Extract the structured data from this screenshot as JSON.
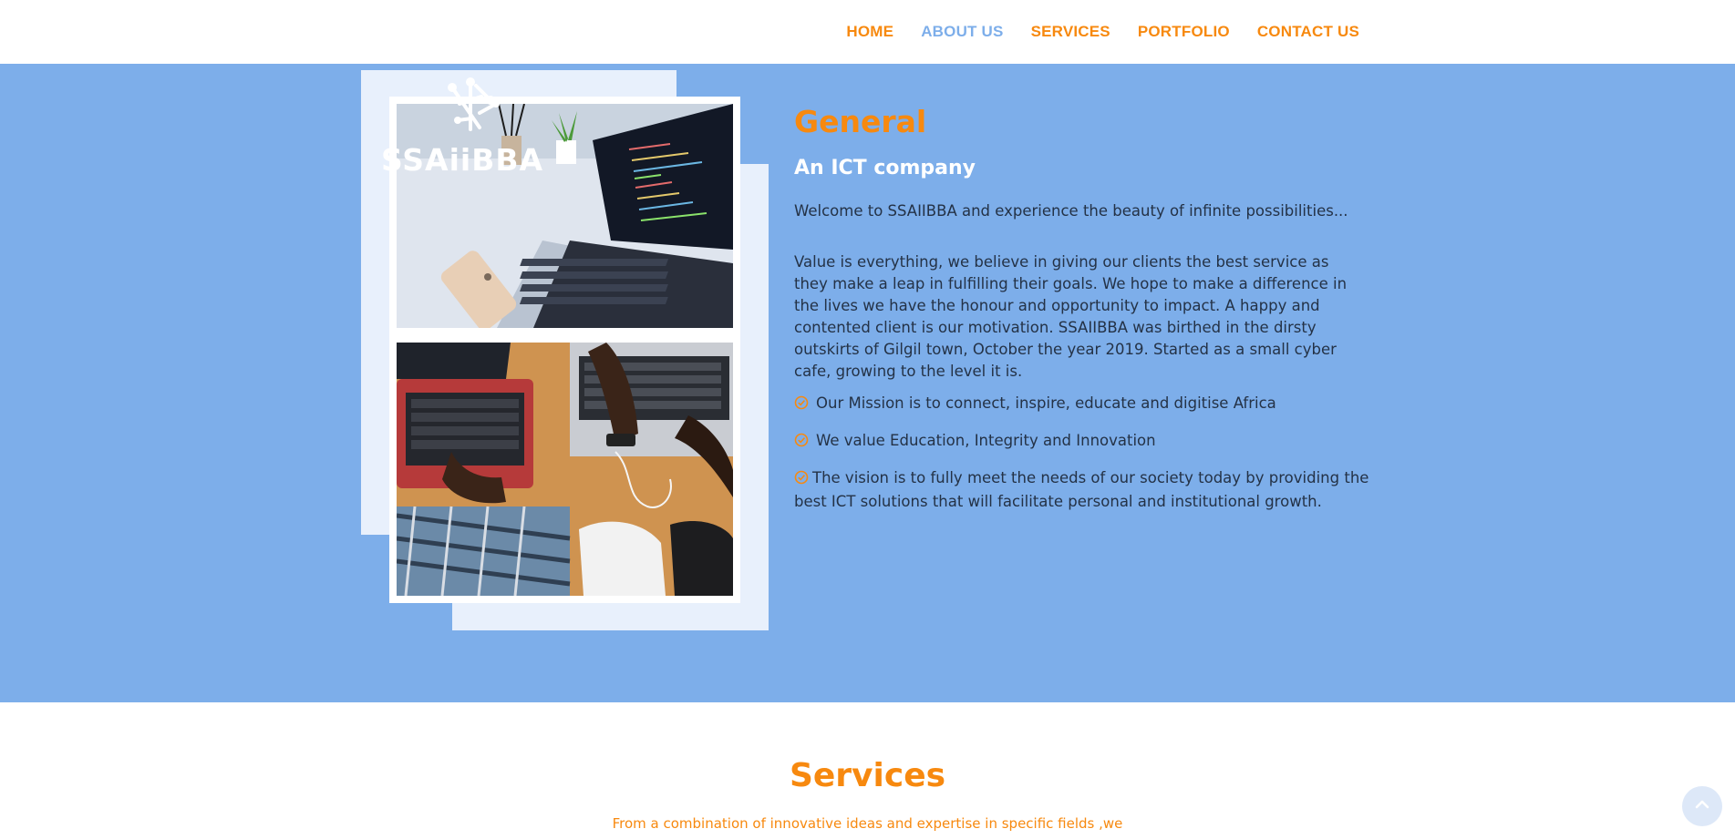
{
  "nav": {
    "items": [
      {
        "label": "HOME"
      },
      {
        "label": "ABOUT US"
      },
      {
        "label": "SERVICES"
      },
      {
        "label": "PORTFOLIO"
      },
      {
        "label": "CONTACT US"
      }
    ],
    "active": "ABOUT US"
  },
  "brand": {
    "logo_text": "SSAiiBBA"
  },
  "about": {
    "title": "General",
    "subtitle": "An ICT company",
    "welcome": "Welcome to SSAIIBBA and experience the beauty of infinite possibilities...",
    "value_paragraph": "Value is everything, we believe in giving our clients the best service as they make a leap in fulfilling their goals. We hope to make a difference in the lives we have the honour and opportunity to impact. A happy and contented client is our motivation. SSAIIBBA was birthed in the dirsty outskirts of Gilgil town, October the year 2019. Started as a small cyber cafe, growing to the level it is.",
    "points": [
      {
        "text": "Our Mission is to connect, inspire, educate and digitise Africa"
      },
      {
        "text": "We value Education, Integrity and Innovation"
      },
      {
        "text": "The vision is to fully meet the needs of our society today by providing the best ICT solutions that will facilitate personal and institutional growth."
      }
    ]
  },
  "services": {
    "title": "Services",
    "lead": "From a combination of innovative ideas and expertise in specific fields ,we"
  },
  "colors": {
    "accent": "#f7890f",
    "primary_blue": "#7daeea",
    "body_text": "#243246"
  },
  "icons": {
    "check": "check-circle-icon",
    "back_to_top": "chevron-up-icon"
  }
}
